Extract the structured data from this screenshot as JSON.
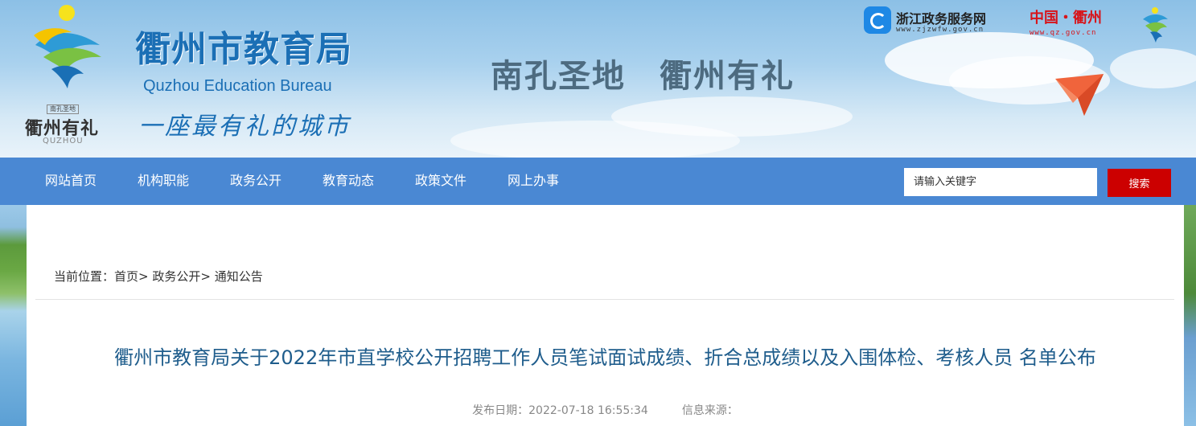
{
  "header": {
    "site_title": "衢州市教育局",
    "site_subtitle": "Quzhou Education Bureau",
    "slogan": "一座最有礼的城市",
    "motto": "南孔圣地　衢州有礼",
    "logo": {
      "seal_text": "南孔圣地",
      "name": "衢州有礼",
      "pinyin": "QUZHOU"
    },
    "zj_portal": {
      "name": "浙江政务服务网",
      "url": "www.zjzwfw.gov.cn"
    },
    "qz_portal": {
      "name": "中国・衢州",
      "url": "www.qz.gov.cn"
    }
  },
  "nav": {
    "items": [
      "网站首页",
      "机构职能",
      "政务公开",
      "教育动态",
      "政策文件",
      "网上办事"
    ],
    "search_placeholder": "请输入关键字",
    "search_button": "搜索"
  },
  "breadcrumb": {
    "prefix": "当前位置：",
    "items": [
      "首页>",
      "政务公开>",
      "通知公告"
    ]
  },
  "article": {
    "title": "衢州市教育局关于2022年市直学校公开招聘工作人员笔试面试成绩、折合总成绩以及入围体检、考核人员 名单公布",
    "publish_label": "发布日期：",
    "publish_date": "2022-07-18 16:55:34",
    "source_label": "信息来源："
  },
  "colors": {
    "nav_bg": "#4a88d3",
    "title_blue": "#1b6fb5",
    "search_btn": "#cc0000",
    "portal_red": "#d7141a"
  }
}
